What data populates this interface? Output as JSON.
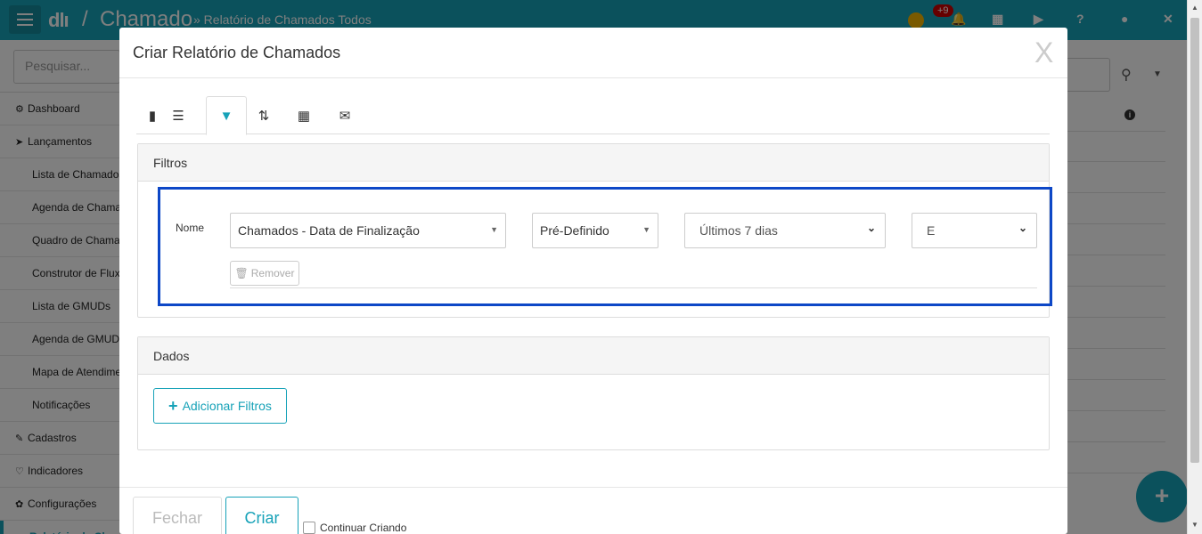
{
  "app": {
    "logo": "dlı",
    "separator": "/",
    "module": "Chamado",
    "breadcrumb": "» Relatório de Chamados Todos",
    "notif_count": "+9",
    "search_placeholder": "Pesquisar..."
  },
  "sidebar": {
    "items": [
      {
        "label": "Dashboard",
        "icon": "dashboard-icon",
        "glyph": "⚙",
        "level": "main"
      },
      {
        "label": "Lançamentos",
        "icon": "send-icon",
        "glyph": "➤",
        "level": "main"
      },
      {
        "label": "Lista de Chamados",
        "level": "sub"
      },
      {
        "label": "Agenda de Chamados",
        "level": "sub"
      },
      {
        "label": "Quadro de Chamados",
        "level": "sub"
      },
      {
        "label": "Construtor de Fluxo",
        "level": "sub"
      },
      {
        "label": "Lista de GMUDs",
        "level": "sub"
      },
      {
        "label": "Agenda de GMUD",
        "level": "sub"
      },
      {
        "label": "Mapa de Atendimento",
        "level": "sub"
      },
      {
        "label": "Notificações",
        "level": "sub"
      },
      {
        "label": "Cadastros",
        "icon": "edit-icon",
        "glyph": "✎",
        "level": "main"
      },
      {
        "label": "Indicadores",
        "icon": "heart-icon",
        "glyph": "♡",
        "level": "main"
      },
      {
        "label": "Configurações",
        "icon": "gear-icon",
        "glyph": "✿",
        "level": "main"
      },
      {
        "label": "Relatório de Chamados",
        "level": "sub",
        "active": true
      }
    ]
  },
  "modal": {
    "title": "Criar Relatório de Chamados",
    "close": "X",
    "tabs": [
      {
        "icon": "book-icon",
        "glyph": "▮"
      },
      {
        "icon": "list-icon",
        "glyph": "☰"
      },
      {
        "icon": "filter-icon",
        "glyph": "▼",
        "active": true
      },
      {
        "icon": "sort-icon",
        "glyph": "⇅"
      },
      {
        "icon": "calendar-icon",
        "glyph": "▦"
      },
      {
        "icon": "envelope-icon",
        "glyph": "✉"
      }
    ],
    "filters_panel": {
      "title": "Filtros",
      "label": "Nome",
      "field_value": "Chamados - Data de Finalização",
      "mode_value": "Pré-Definido",
      "period_value": "Últimos 7 dias",
      "logic_value": "E",
      "remove_label": "Remover"
    },
    "data_panel": {
      "title": "Dados",
      "add_filters_label": "Adicionar Filtros"
    },
    "footer": {
      "close_label": "Fechar",
      "create_label": "Criar",
      "continue_label": "Continuar Criando"
    }
  },
  "colors": {
    "accent": "#17a2b8",
    "highlight_border": "#0d47c7",
    "badge": "#cc0000"
  }
}
